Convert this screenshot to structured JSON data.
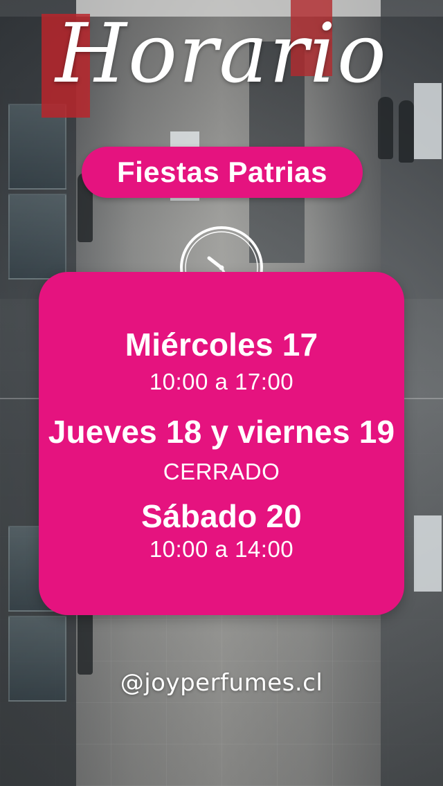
{
  "title": "Horario",
  "subtitle": "Fiestas Patrias",
  "icons": {
    "clock": "clock-icon"
  },
  "colors": {
    "accent": "#e5137f",
    "text": "#ffffff"
  },
  "schedule": [
    {
      "day": "Miércoles 17",
      "hours": "10:00 a 17:00"
    },
    {
      "day": "Jueves 18 y viernes 19",
      "hours": "CERRADO"
    },
    {
      "day": "Sábado 20",
      "hours": "10:00 a 14:00"
    }
  ],
  "handle": "@joyperfumes.cl"
}
